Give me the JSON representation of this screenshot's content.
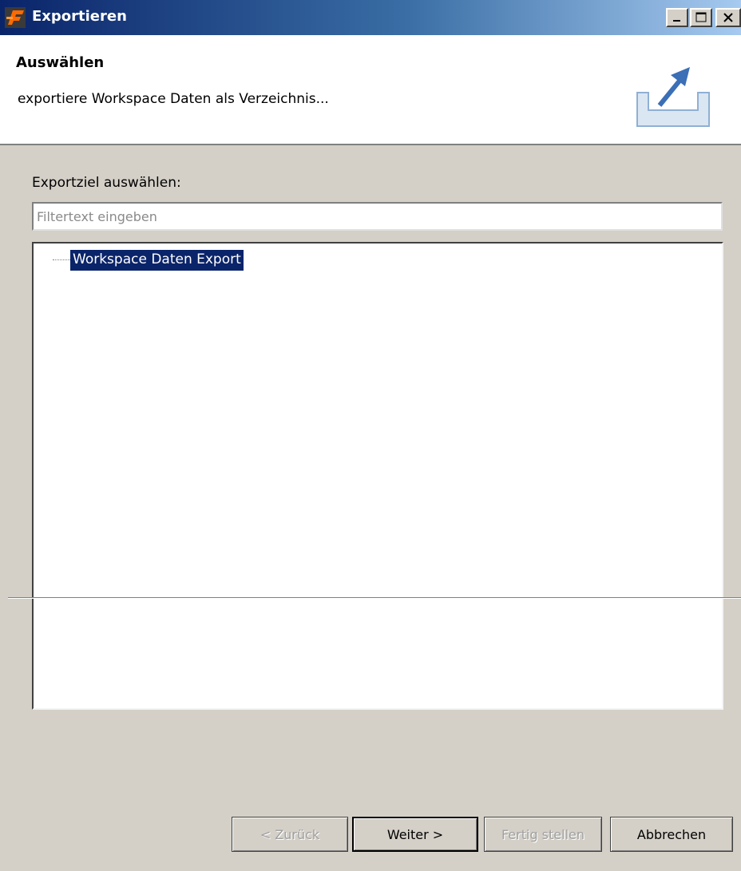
{
  "window": {
    "title": "Exportieren",
    "app_icon": "orange-f-logo-icon",
    "controls": [
      "minimize-icon",
      "maximize-icon",
      "close-icon"
    ]
  },
  "banner": {
    "title": "Auswählen",
    "description": "exportiere Workspace Daten als Verzeichnis...",
    "icon": "export-tray-arrow-icon"
  },
  "content": {
    "target_label": "Exportziel auswählen:",
    "filter": {
      "placeholder": "Filtertext eingeben",
      "value": ""
    },
    "tree": {
      "items": [
        {
          "label": "Workspace Daten Export",
          "selected": true
        }
      ]
    }
  },
  "buttons": {
    "back": {
      "label": "< Zurück",
      "enabled": false
    },
    "next": {
      "label": "Weiter >",
      "enabled": true,
      "default": true
    },
    "finish": {
      "label": "Fertig stellen",
      "enabled": false
    },
    "cancel": {
      "label": "Abbrechen",
      "enabled": true
    }
  },
  "colors": {
    "selection": "#0a246a",
    "titlebar_start": "#0a246a",
    "titlebar_end": "#a6caf0",
    "dialog_bg": "#d4d0c8"
  }
}
